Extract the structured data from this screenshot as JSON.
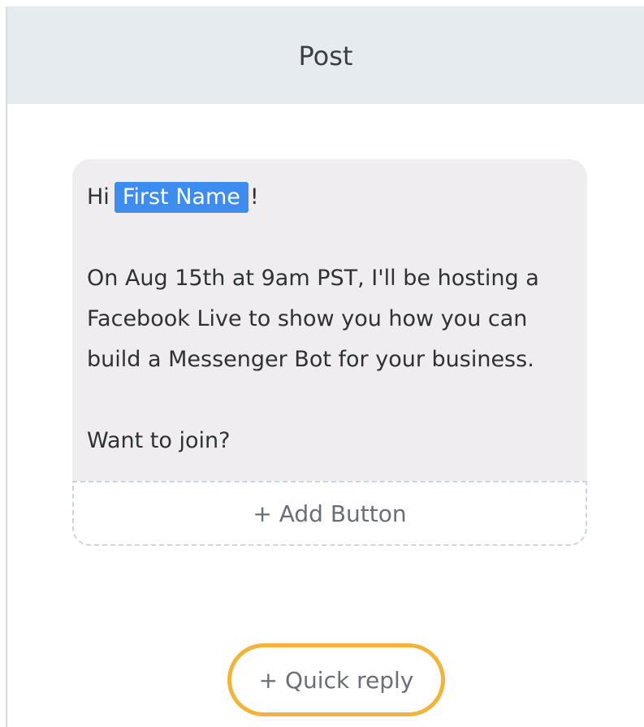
{
  "header": {
    "title": "Post"
  },
  "message": {
    "greeting_prefix": "Hi",
    "variable_tag": "First Name",
    "greeting_suffix": "!",
    "body": "On Aug 15th at 9am PST, I'll be hosting a Facebook Live to show you how you can build a Messenger Bot for your business.",
    "question": "Want to join?"
  },
  "actions": {
    "add_button": "+ Add Button",
    "quick_reply": "+ Quick reply"
  },
  "colors": {
    "header_bg": "#e6ebf0",
    "card_bg": "#efedef",
    "tag_bg": "#3d8cef",
    "highlight_ring": "#f1b43a"
  }
}
